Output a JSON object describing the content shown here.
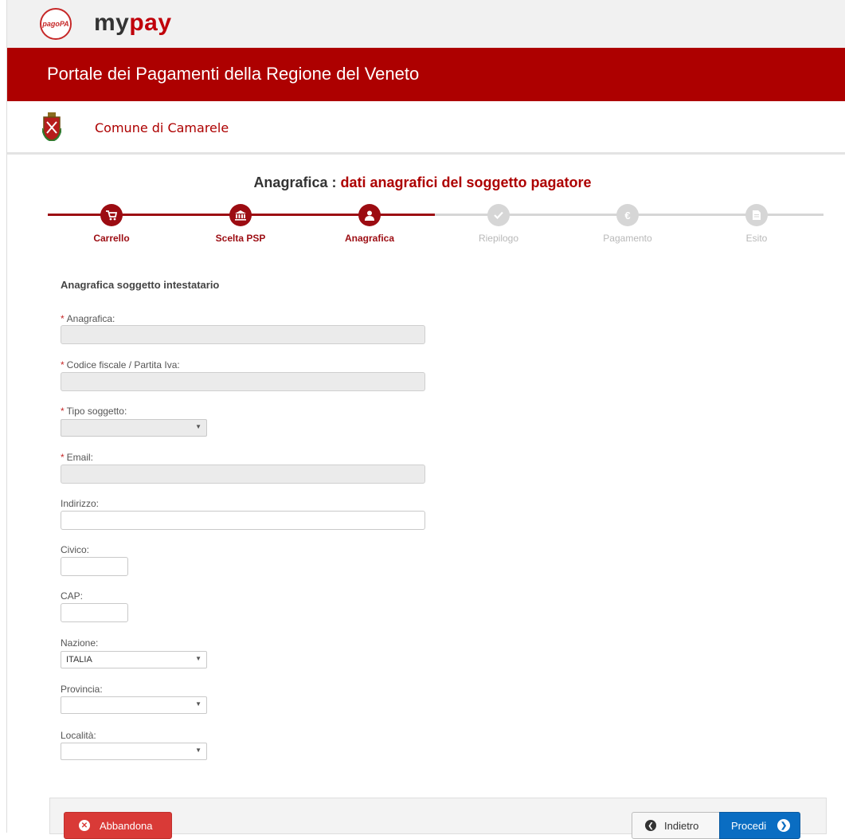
{
  "brand": {
    "pagopa_logo": "pagoPA",
    "mypay_my": "my",
    "mypay_pay": "pay"
  },
  "header": {
    "title": "Portale dei Pagamenti della Regione del Veneto"
  },
  "ente": {
    "name": "Comune di Camarele"
  },
  "heading": {
    "prefix": "Anagrafica :",
    "suffix": "dati anagrafici del soggetto pagatore"
  },
  "steps": [
    {
      "label": "Carrello",
      "icon": "cart-icon",
      "state": "done"
    },
    {
      "label": "Scelta PSP",
      "icon": "bank-icon",
      "state": "done"
    },
    {
      "label": "Anagrafica",
      "icon": "user-icon",
      "state": "current"
    },
    {
      "label": "Riepilogo",
      "icon": "check-icon",
      "state": "todo"
    },
    {
      "label": "Pagamento",
      "icon": "euro-icon",
      "state": "todo"
    },
    {
      "label": "Esito",
      "icon": "document-icon",
      "state": "todo"
    }
  ],
  "form": {
    "section_title": "Anagrafica soggetto intestatario",
    "required_mark": "*",
    "anagrafica_label": "Anagrafica:",
    "anagrafica_value": "",
    "codice_fiscale_label": "Codice fiscale / Partita Iva:",
    "codice_fiscale_value": "",
    "tipo_soggetto_label": "Tipo soggetto:",
    "tipo_soggetto_value": "",
    "email_label": "Email:",
    "email_value": "",
    "indirizzo_label": "Indirizzo:",
    "indirizzo_value": "",
    "civico_label": "Civico:",
    "civico_value": "",
    "cap_label": "CAP:",
    "cap_value": "",
    "nazione_label": "Nazione:",
    "nazione_value": "ITALIA",
    "provincia_label": "Provincia:",
    "provincia_value": "",
    "localita_label": "Località:",
    "localita_value": ""
  },
  "actions": {
    "abbandona": "Abbandona",
    "indietro": "Indietro",
    "procedi": "Procedi"
  },
  "colors": {
    "header_red": "#ad0000",
    "step_active": "#9c0c12",
    "step_inactive": "#d6d6d6",
    "danger": "#d93a37",
    "primary": "#0a6dc2"
  }
}
